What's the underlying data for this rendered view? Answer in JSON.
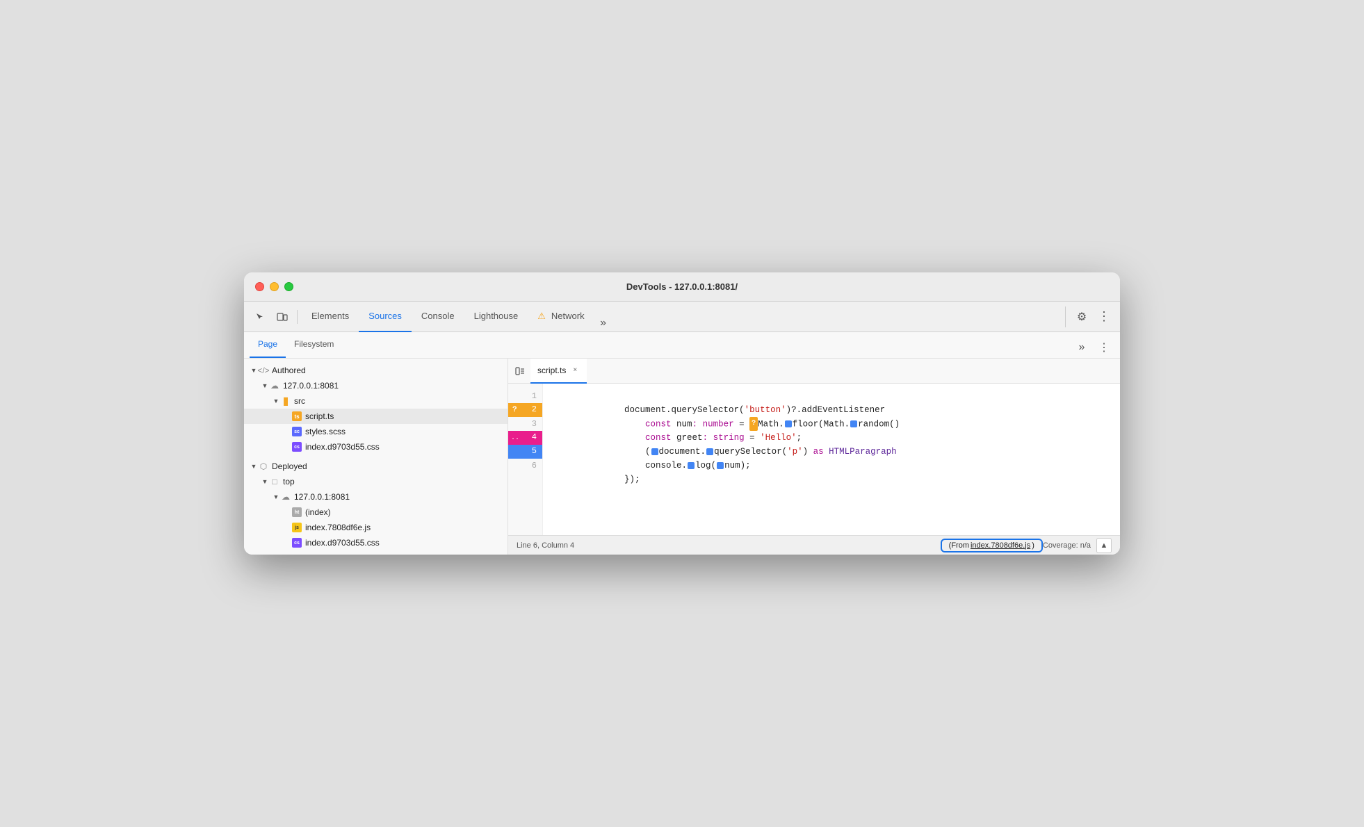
{
  "window": {
    "title": "DevTools - 127.0.0.1:8081/"
  },
  "toolbar": {
    "tabs": [
      {
        "id": "elements",
        "label": "Elements",
        "active": false,
        "warning": false
      },
      {
        "id": "sources",
        "label": "Sources",
        "active": true,
        "warning": false
      },
      {
        "id": "console",
        "label": "Console",
        "active": false,
        "warning": false
      },
      {
        "id": "lighthouse",
        "label": "Lighthouse",
        "active": false,
        "warning": false
      },
      {
        "id": "network",
        "label": "Network",
        "active": false,
        "warning": true
      }
    ],
    "more_label": "»",
    "settings_icon": "⚙",
    "more_icon": "⋮"
  },
  "left_panel": {
    "sub_tabs": [
      {
        "id": "page",
        "label": "Page",
        "active": true
      },
      {
        "id": "filesystem",
        "label": "Filesystem",
        "active": false
      }
    ],
    "more_label": "»",
    "tree": [
      {
        "id": "authored",
        "label": "Authored",
        "type": "section",
        "icon": "tag",
        "indent": 0,
        "expanded": true,
        "arrow": "▼"
      },
      {
        "id": "server1",
        "label": "127.0.0.1:8081",
        "type": "cloud",
        "indent": 1,
        "expanded": true,
        "arrow": "▼"
      },
      {
        "id": "src",
        "label": "src",
        "type": "folder",
        "indent": 2,
        "expanded": true,
        "arrow": "▼"
      },
      {
        "id": "script_ts",
        "label": "script.ts",
        "type": "ts",
        "indent": 3,
        "selected": true
      },
      {
        "id": "styles_scss",
        "label": "styles.scss",
        "type": "scss",
        "indent": 3
      },
      {
        "id": "index_css1",
        "label": "index.d9703d55.css",
        "type": "css",
        "indent": 3
      },
      {
        "id": "deployed",
        "label": "Deployed",
        "type": "cube",
        "indent": 0,
        "expanded": true,
        "arrow": "▼"
      },
      {
        "id": "top",
        "label": "top",
        "type": "box",
        "indent": 1,
        "expanded": true,
        "arrow": "▼"
      },
      {
        "id": "server2",
        "label": "127.0.0.1:8081",
        "type": "cloud",
        "indent": 2,
        "expanded": true,
        "arrow": "▼"
      },
      {
        "id": "index_html",
        "label": "(index)",
        "type": "html",
        "indent": 3
      },
      {
        "id": "index_js",
        "label": "index.7808df6e.js",
        "type": "js",
        "indent": 3
      },
      {
        "id": "index_css2",
        "label": "index.d9703d55.css",
        "type": "css",
        "indent": 3
      }
    ]
  },
  "editor": {
    "file_tab": "script.ts",
    "lines": [
      {
        "num": 1,
        "type": "normal",
        "content": "document.querySelector('button')?.addEventListener"
      },
      {
        "num": 2,
        "type": "breakpoint_orange",
        "content": "    const num: number = Math.floor(Math.random()"
      },
      {
        "num": 3,
        "type": "normal",
        "content": "    const greet: string = 'Hello';"
      },
      {
        "num": 4,
        "type": "breakpoint_pink",
        "content": "    (document.querySelector('p') as HTMLParagraph"
      },
      {
        "num": 5,
        "type": "breakpoint_blue",
        "content": "    console.log(num);"
      },
      {
        "num": 6,
        "type": "normal",
        "content": "});"
      }
    ]
  },
  "status_bar": {
    "position": "Line 6, Column 4",
    "source_link_prefix": "(From ",
    "source_link_file": "index.7808df6e.js",
    "source_link_suffix": ")",
    "coverage": "Coverage: n/a"
  },
  "colors": {
    "active_tab": "#1a73e8",
    "breakpoint_orange": "#f5a623",
    "breakpoint_pink": "#e91e8c",
    "breakpoint_blue": "#4285f4"
  }
}
